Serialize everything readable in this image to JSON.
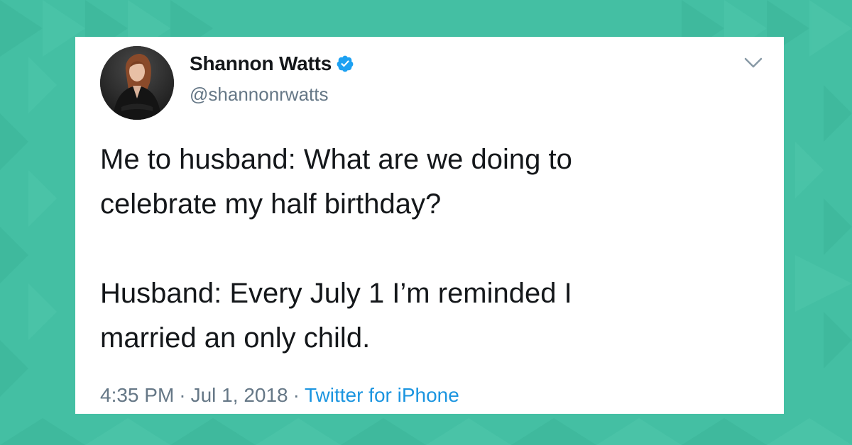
{
  "colors": {
    "background": "#44bfa3",
    "card": "#ffffff",
    "text": "#14171a",
    "secondary_text": "#657786",
    "link": "#1b95e0",
    "verified_badge": "#1da1f2"
  },
  "tweet": {
    "author": {
      "display_name": "Shannon Watts",
      "handle": "@shannonrwatts",
      "verified": true,
      "verified_icon": "verified-badge-icon"
    },
    "menu_icon": "chevron-down-icon",
    "paragraphs": [
      "Me to husband: What are we doing to\ncelebrate my half birthday?",
      "Husband: Every July 1 I’m reminded I\nmarried an only child."
    ],
    "time": "4:35 PM",
    "date": "Jul 1, 2018",
    "separator": "·",
    "source": "Twitter for iPhone"
  }
}
